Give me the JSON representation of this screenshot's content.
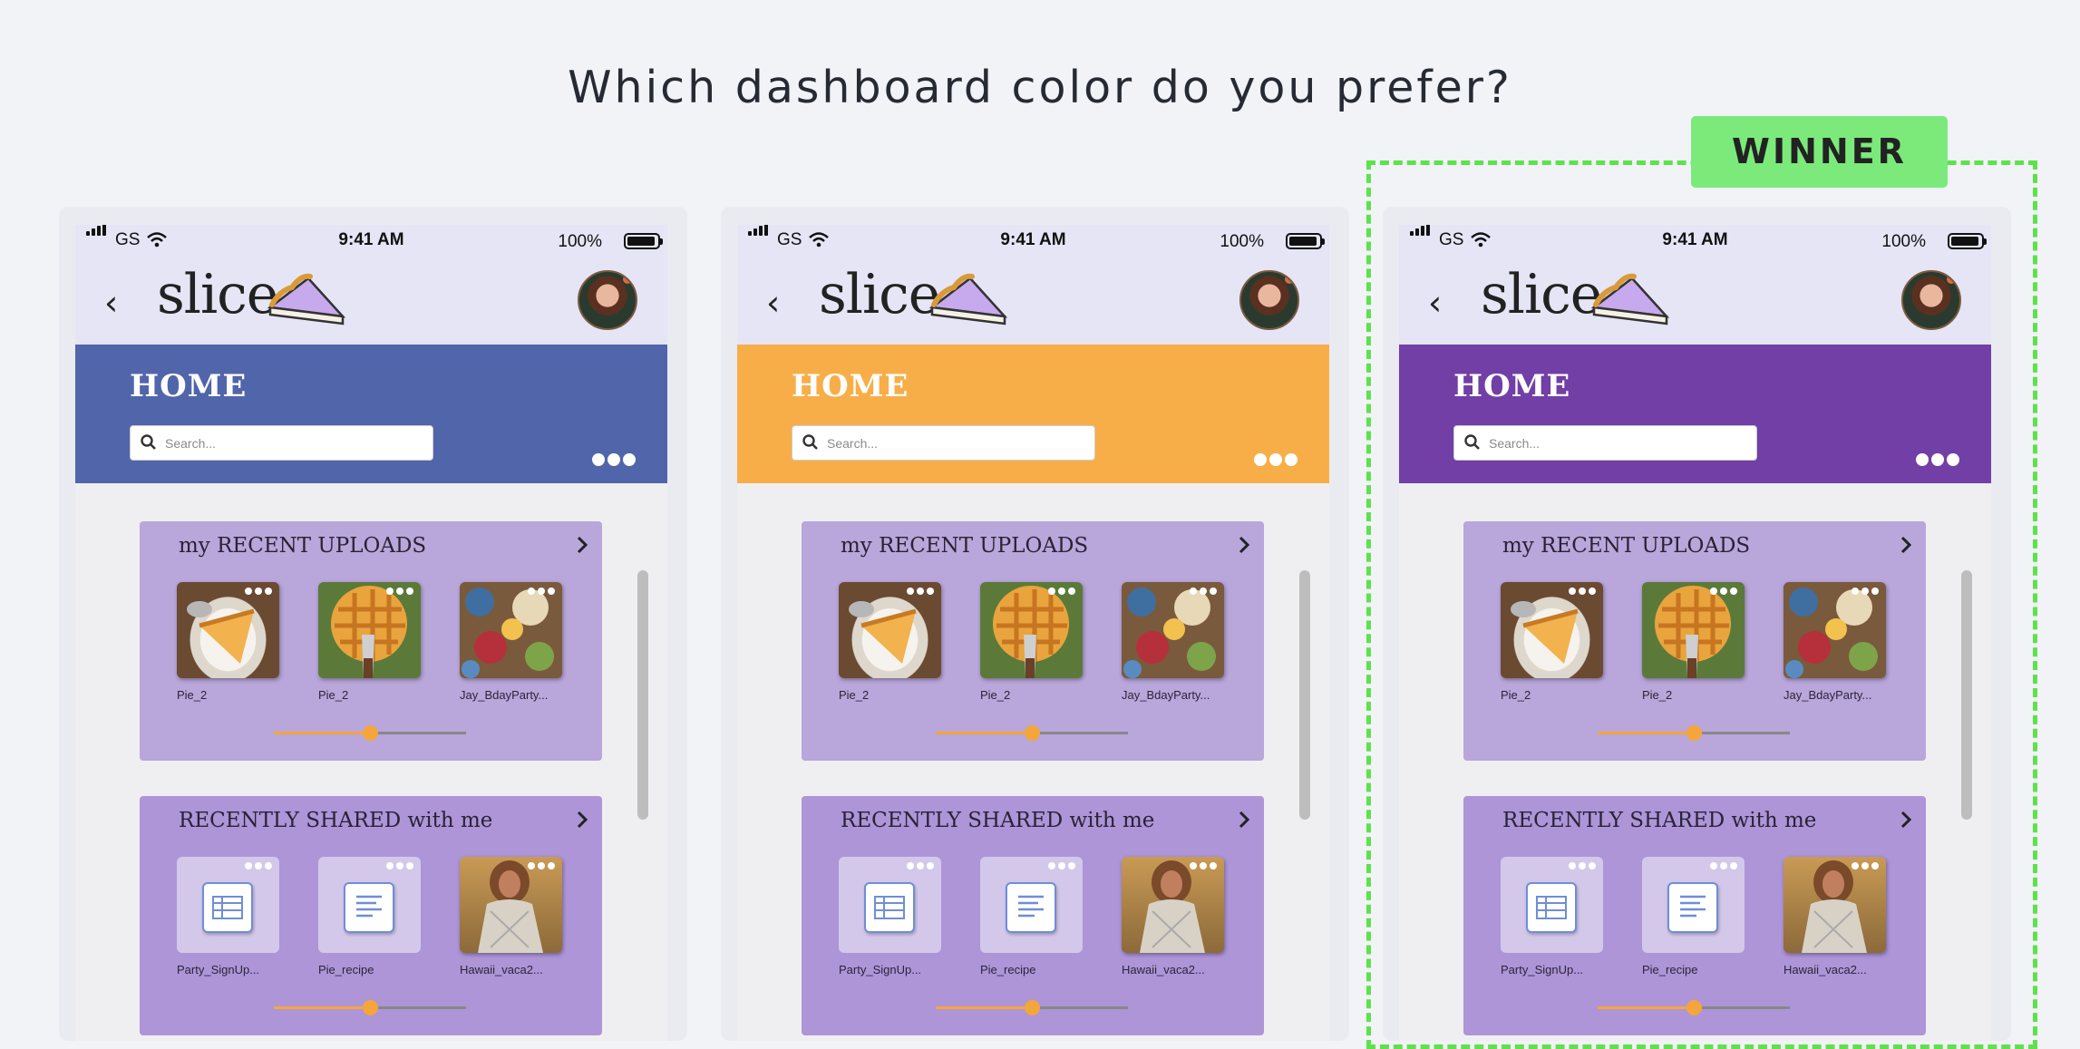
{
  "page": {
    "title": "Which dashboard color do you prefer?"
  },
  "winner": {
    "label": "WINNER"
  },
  "status_bar": {
    "carrier": "GS",
    "time": "9:41 AM",
    "battery": "100%"
  },
  "app": {
    "logo_text": "slice",
    "home_title": "HOME",
    "search_placeholder": "Search..."
  },
  "variants": [
    {
      "name": "blue",
      "banner_color": "#5165aa"
    },
    {
      "name": "orange",
      "banner_color": "#f8ae48"
    },
    {
      "name": "purple",
      "banner_color": "#713fa6"
    }
  ],
  "recent_uploads": {
    "title": "my RECENT UPLOADS",
    "items": [
      {
        "label": "Pie_2",
        "image": "pie-slice-photo"
      },
      {
        "label": "Pie_2",
        "image": "pie-server-photo"
      },
      {
        "label": "Jay_BdayParty...",
        "image": "party-table-photo"
      }
    ],
    "position": 0.5
  },
  "recently_shared": {
    "title": "RECENTLY SHARED with me",
    "items": [
      {
        "label": "Party_SignUp...",
        "image": "spreadsheet-icon"
      },
      {
        "label": "Pie_recipe",
        "image": "document-icon"
      },
      {
        "label": "Hawaii_vaca2...",
        "image": "woman-photo"
      }
    ],
    "position": 0.5
  },
  "colors": {
    "panel_top": "#b9a6da",
    "panel_bottom": "#ad95d8",
    "accent": "#f5a63b",
    "winner_green": "#7bea7b"
  }
}
